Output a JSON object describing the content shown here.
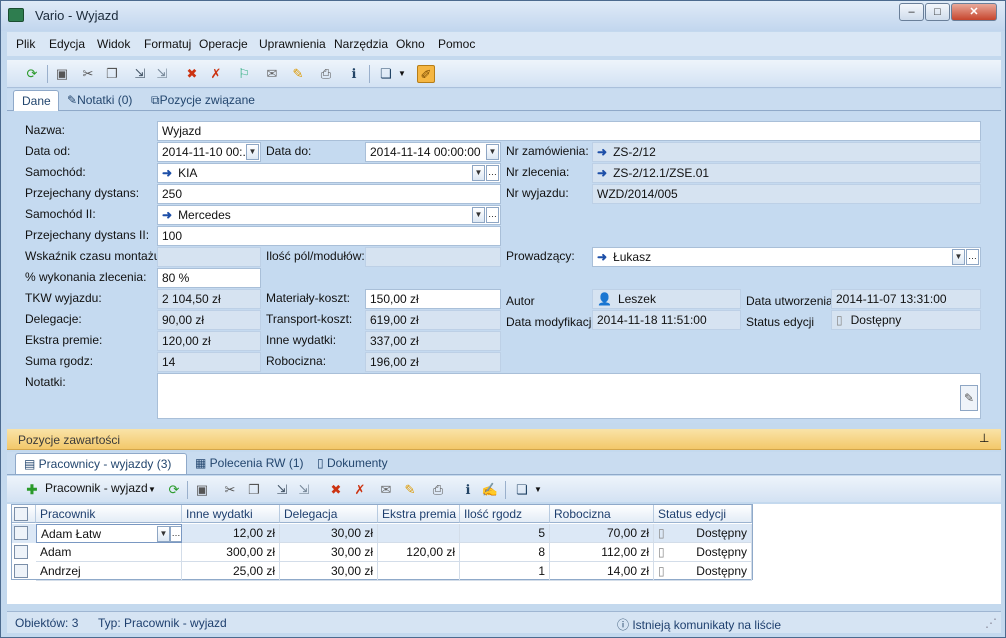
{
  "window": {
    "app": "Vario",
    "title": "Wyjazd",
    "min": "–",
    "max": "□",
    "close": "✕"
  },
  "menu": [
    "Plik",
    "Edycja",
    "Widok",
    "Formatuj",
    "Operacje",
    "Uprawnienia",
    "Narzędzia",
    "Okno",
    "Pomoc"
  ],
  "tabs_top": [
    {
      "label": "Dane"
    },
    {
      "label": "Notatki (0)"
    },
    {
      "label": "Pozycje związane"
    }
  ],
  "form": {
    "nazwa_label": "Nazwa:",
    "nazwa": "Wyjazd",
    "data_od_label": "Data od:",
    "data_od": "2014-11-10 00:...",
    "data_do_label": "Data do:",
    "data_do": "2014-11-14 00:00:00",
    "nr_zamowienia_label": "Nr zamówienia:",
    "nr_zamowienia": "ZS-2/12",
    "samochod_label": "Samochód:",
    "samochod": "KIA",
    "nr_zlecenia_label": "Nr zlecenia:",
    "nr_zlecenia": "ZS-2/12.1/ZSE.01",
    "dystans_label": "Przejechany dystans:",
    "dystans": "250",
    "nr_wyjazdu_label": "Nr wyjazdu:",
    "nr_wyjazdu": "WZD/2014/005",
    "samochod2_label": "Samochód II:",
    "samochod2": "Mercedes",
    "dystans2_label": "Przejechany dystans II:",
    "dystans2": "100",
    "wskaznik_label": "Wskaźnik czasu montażu:",
    "wskaznik": "",
    "ilosc_pol_label": "Ilość pól/modułów:",
    "ilosc_pol": "",
    "prowadzacy_label": "Prowadzący:",
    "prowadzacy": "Łukasz",
    "wykonanie_label": "% wykonania zlecenia:",
    "wykonanie": "80 %",
    "tkw_label": "TKW wyjazdu:",
    "tkw": "2 104,50 zł",
    "materialy_label": "Materiały-koszt:",
    "materialy": "150,00 zł",
    "autor_label": "Autor",
    "autor": "Leszek",
    "data_utworzenia_label": "Data utworzenia",
    "data_utworzenia": "2014-11-07 13:31:00",
    "delegacje_label": "Delegacje:",
    "delegacje": "90,00 zł",
    "transport_label": "Transport-koszt:",
    "transport": "619,00 zł",
    "data_modyfikacji_label": "Data modyfikacji",
    "data_modyfikacji": "2014-11-18 11:51:00",
    "status_edycji_label": "Status edycji",
    "status_edycji": "Dostępny",
    "ekstra_label": "Ekstra premie:",
    "ekstra": "120,00 zł",
    "inne_label": "Inne wydatki:",
    "inne": "337,00 zł",
    "suma_label": "Suma rgodz:",
    "suma": "14",
    "robocizna_label": "Robocizna:",
    "robocizna": "196,00 zł",
    "notatki_label": "Notatki:",
    "notatki": ""
  },
  "section_title": "Pozycje zawartości",
  "tabs_bottom": [
    {
      "label": "Pracownicy - wyjazdy (3)"
    },
    {
      "label": "Polecenia RW (1)"
    },
    {
      "label": "Dokumenty"
    }
  ],
  "toolbar2": {
    "add_label": "Pracownik - wyjazd"
  },
  "grid": {
    "columns": [
      "Pracownik",
      "Inne wydatki",
      "Delegacja",
      "Ekstra premia",
      "Ilość rgodz",
      "Robocizna",
      "Status edycji"
    ],
    "rows": [
      [
        "Adam Łatw",
        "12,00 zł",
        "30,00 zł",
        "",
        "5",
        "70,00 zł",
        "Dostępny"
      ],
      [
        "Adam",
        "300,00 zł",
        "30,00 zł",
        "120,00 zł",
        "8",
        "112,00 zł",
        "Dostępny"
      ],
      [
        "Andrzej",
        "25,00 zł",
        "30,00 zł",
        "",
        "1",
        "14,00 zł",
        "Dostępny"
      ]
    ]
  },
  "status": {
    "objects": "Obiektów: 3",
    "type": "Typ: Pracownik - wyjazd",
    "message": "Istnieją komunikaty na liście"
  }
}
